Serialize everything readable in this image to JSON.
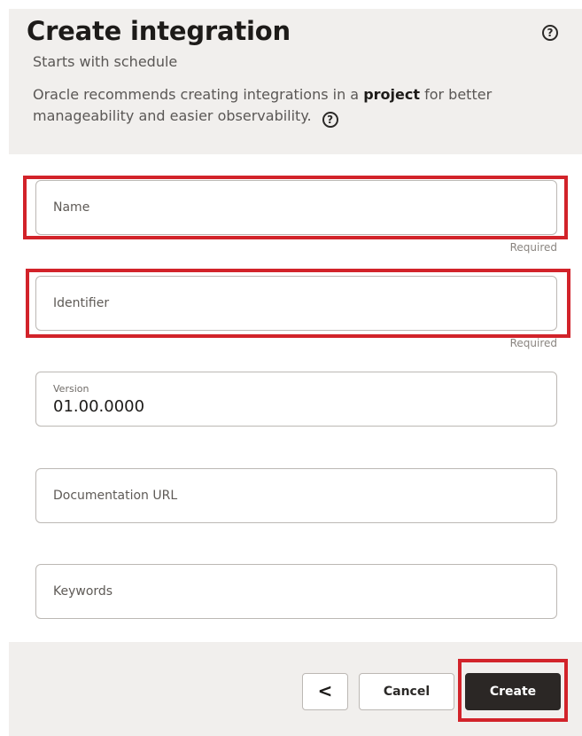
{
  "header": {
    "title": "Create integration",
    "subtitle": "Starts with schedule",
    "recommend_prefix": "Oracle recommends creating integrations in a ",
    "recommend_bold": "project",
    "recommend_suffix": " for better manageability and easier observability.",
    "help_icon": "?"
  },
  "form": {
    "name": {
      "placeholder": "Name",
      "value": "",
      "hint": "Required"
    },
    "identifier": {
      "placeholder": "Identifier",
      "value": "",
      "hint": "Required"
    },
    "version": {
      "label": "Version",
      "value": "01.00.0000"
    },
    "documentation_url": {
      "placeholder": "Documentation URL",
      "value": ""
    },
    "keywords": {
      "placeholder": "Keywords",
      "value": ""
    }
  },
  "footer": {
    "back_label": "<",
    "cancel_label": "Cancel",
    "create_label": "Create"
  },
  "colors": {
    "highlight": "#d2232a",
    "panel_bg": "#f1efed",
    "primary_button": "#2b2725"
  }
}
